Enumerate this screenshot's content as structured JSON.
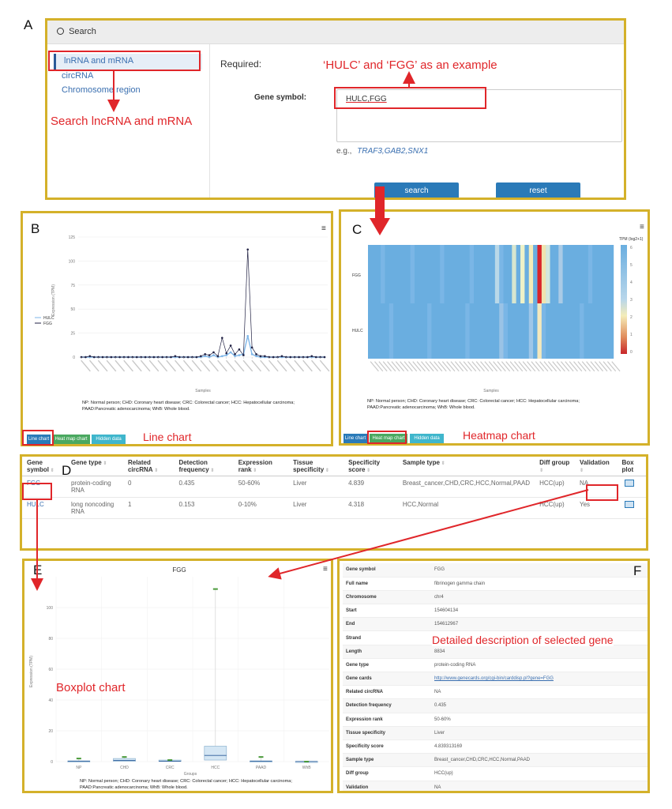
{
  "colors": {
    "panel_border": "#d4b12a",
    "annotation_red": "#e0262a",
    "button_blue": "#2a7ab8",
    "link_blue": "#3a6fb0",
    "heat_blue": "#6aaee0",
    "fgg_line": "#222244",
    "hulc_line": "#7eb6e8"
  },
  "panel_letters": {
    "a": "A",
    "b": "B",
    "c": "C",
    "d": "D",
    "e": "E",
    "f": "F"
  },
  "search_panel": {
    "header": "Search",
    "header_icon": "search-icon",
    "sidebar": [
      {
        "label": "lnRNA and mRNA"
      },
      {
        "label": "circRNA"
      },
      {
        "label": "Chromosome region"
      }
    ],
    "required_label": "Required:",
    "gene_symbol_label": "Gene symbol:",
    "gene_symbol_value": "HULC,FGG",
    "example_prefix": "e.g.,",
    "example_values": "TRAF3,GAB2,SNX1",
    "search_button": "search",
    "reset_button": "reset"
  },
  "annotations": {
    "example_note": "‘HULC’ and ‘FGG’ as an example",
    "search_note": "Search lncRNA and mRNA",
    "line_chart": "Line chart",
    "heatmap_chart": "Heatmap chart",
    "boxplot_chart": "Boxplot chart",
    "detail_note": "Detailed description of selected gene"
  },
  "chart_tabs": [
    "Line chart",
    "Heat map chart",
    "Hidden data"
  ],
  "menu_icon": "hamburger-menu-icon",
  "abbrev_note": {
    "line1": "NP: Normal person; CHD: Coronary heart disease; CRC: Colorectal cancer; HCC: Hepatocellular carcinoma;",
    "line2": "PAAD:Pancreatic adenocarcinoma; WhB: Whole blood."
  },
  "line_chart_data": {
    "type": "line",
    "ylabel": "Expression (TPM)",
    "xlabel": "Samples",
    "ylim": [
      0,
      125
    ],
    "yticks": [
      0,
      25,
      50,
      75,
      100,
      125
    ],
    "series": [
      {
        "name": "HULC",
        "values": [
          0,
          0,
          0,
          0,
          0,
          0,
          0,
          0,
          0,
          0,
          0,
          0,
          0,
          0,
          0,
          0,
          0,
          0,
          0,
          0,
          0,
          0,
          0,
          0,
          0,
          0,
          0,
          0,
          0,
          1,
          0,
          2,
          0,
          1,
          2,
          5,
          1,
          2,
          3,
          22,
          3,
          1,
          0,
          0,
          0,
          0,
          0,
          0,
          0,
          0,
          0,
          0,
          0,
          0,
          0,
          0,
          0,
          0
        ]
      },
      {
        "name": "FGG",
        "values": [
          0,
          0,
          1,
          0,
          0,
          0,
          0,
          0,
          0,
          0,
          0,
          0,
          0,
          0,
          0,
          0,
          0,
          0,
          0,
          0,
          0,
          0,
          1,
          0,
          0,
          0,
          0,
          0,
          1,
          3,
          2,
          5,
          1,
          20,
          4,
          12,
          3,
          8,
          2,
          112,
          10,
          3,
          1,
          1,
          0,
          0,
          0,
          1,
          0,
          0,
          0,
          0,
          0,
          0,
          1,
          0,
          0,
          0
        ]
      }
    ]
  },
  "heatmap_data": {
    "type": "heatmap",
    "xlabel": "Samples",
    "rows": [
      "FGG",
      "HULC"
    ],
    "legend_title": "TPM (log2+1)",
    "legend_ticks": [
      "6",
      "5",
      "4",
      "3",
      "2",
      "1",
      "0"
    ]
  },
  "gene_table": {
    "columns": [
      "Gene symbol",
      "Gene type",
      "Related circRNA",
      "Detection frequency",
      "Expression rank",
      "Tissue specificity",
      "Specificity score",
      "Sample type",
      "Diff group",
      "Validation",
      "Box plot"
    ],
    "rows": [
      [
        "FGG",
        "protein-coding RNA",
        "0",
        "0.435",
        "50-60%",
        "Liver",
        "4.839",
        "Breast_cancer,CHD,CRC,HCC,Normal,PAAD",
        "HCC(up)",
        "NA",
        "plot-icon"
      ],
      [
        "HULC",
        "long noncoding RNA",
        "1",
        "0.153",
        "0-10%",
        "Liver",
        "4.318",
        "HCC,Normal",
        "HCC(up)",
        "Yes",
        "plot-icon"
      ]
    ]
  },
  "boxplot_data": {
    "type": "box",
    "title": "FGG",
    "ylabel": "Expression (TPM)",
    "xlabel": "Groups",
    "categories": [
      "NP",
      "CHD",
      "CRC",
      "HCC",
      "PAAD",
      "WhB"
    ],
    "yticks": [
      0,
      20,
      40,
      60,
      80,
      100
    ],
    "ylim": [
      0,
      120
    ],
    "outliers": [
      2,
      3,
      1,
      112,
      3,
      0
    ],
    "box_q1": [
      0,
      0.2,
      0.1,
      1,
      0,
      0
    ],
    "box_q3": [
      0.5,
      2,
      1,
      10,
      0.5,
      0.2
    ],
    "median": [
      0.2,
      0.8,
      0.3,
      4,
      0.2,
      0.05
    ]
  },
  "detail": [
    {
      "key": "Gene symbol",
      "value": "FGG"
    },
    {
      "key": "Full name",
      "value": "fibrinogen gamma chain"
    },
    {
      "key": "Chromosome",
      "value": "chr4"
    },
    {
      "key": "Start",
      "value": "154604134"
    },
    {
      "key": "End",
      "value": "154612967"
    },
    {
      "key": "Strand",
      "value": ""
    },
    {
      "key": "Length",
      "value": "8834"
    },
    {
      "key": "Gene type",
      "value": "protein-coding RNA"
    },
    {
      "key": "Gene cards",
      "value": "http://www.genecards.org/cgi-bin/carddisp.pl?gene=FGG"
    },
    {
      "key": "Related circRNA",
      "value": "NA"
    },
    {
      "key": "Detection frequency",
      "value": "0.435"
    },
    {
      "key": "Expression rank",
      "value": "50-60%"
    },
    {
      "key": "Tissue specificity",
      "value": "Liver"
    },
    {
      "key": "Specificity score",
      "value": "4.839313169"
    },
    {
      "key": "Sample type",
      "value": "Breast_cancer,CHD,CRC,HCC,Normal,PAAD"
    },
    {
      "key": "Diff group",
      "value": "HCC(up)"
    },
    {
      "key": "Validation",
      "value": "NA"
    }
  ]
}
